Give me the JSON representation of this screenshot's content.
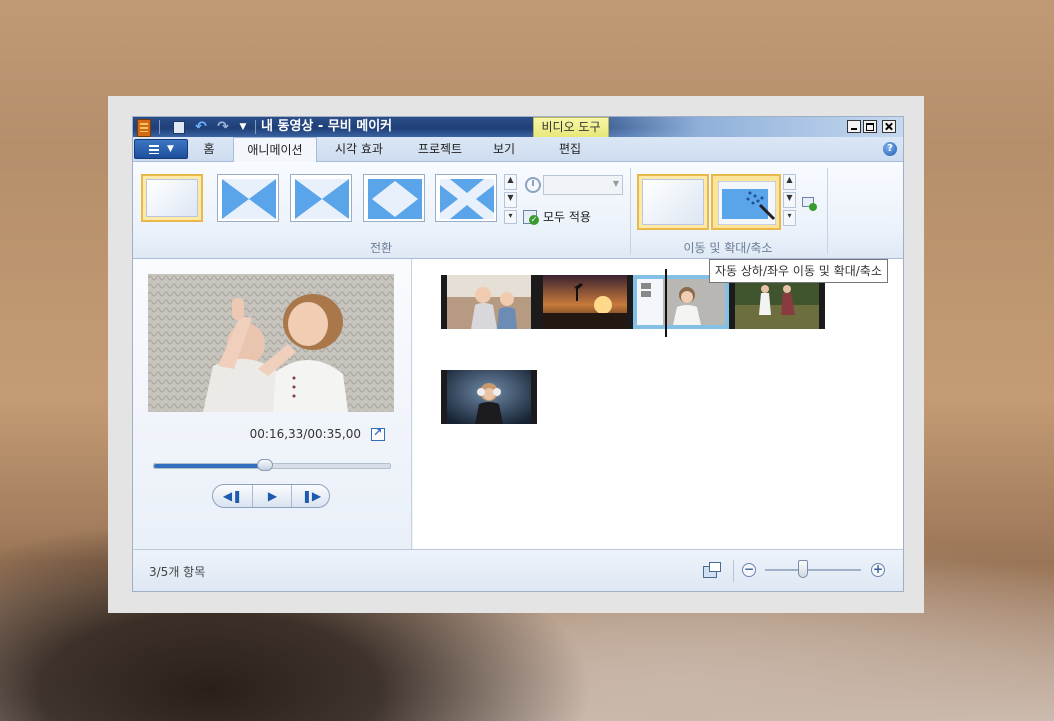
{
  "window": {
    "title": "내 동영상 - 무비 메이커",
    "context_tab": "비디오 도구"
  },
  "tabs": [
    {
      "label": "홈"
    },
    {
      "label": "애니메이션",
      "active": true
    },
    {
      "label": "시각 효과"
    },
    {
      "label": "프로젝트"
    },
    {
      "label": "보기"
    },
    {
      "label": "편집"
    }
  ],
  "ribbon": {
    "transitions_group_label": "전환",
    "apply_all_label": "모두 적용",
    "duration_value": "",
    "panzoom_group_label": "이동 및 확대/축소",
    "tooltip": "자동 상하/좌우 이동 및 확대/축소"
  },
  "preview": {
    "timecode": "00:16,33/00:35,00",
    "progress": 0.47
  },
  "status": {
    "items_text": "3/5개 항목",
    "zoom_level": 0.4
  },
  "colors": {
    "accent": "#1e5bb0",
    "selection": "#e8b84a",
    "title_bar": "#1f3f77",
    "context_tab": "#e7e77a"
  },
  "icons": [
    "app-icon",
    "save-icon",
    "undo-icon",
    "redo-icon",
    "quick-access-more-icon",
    "file-menu-icon",
    "help-icon",
    "duration-clock-icon",
    "apply-all-icon",
    "popout-icon",
    "previous-frame-icon",
    "play-icon",
    "next-frame-icon",
    "storyboard-view-icon",
    "zoom-out-icon",
    "zoom-in-icon"
  ]
}
